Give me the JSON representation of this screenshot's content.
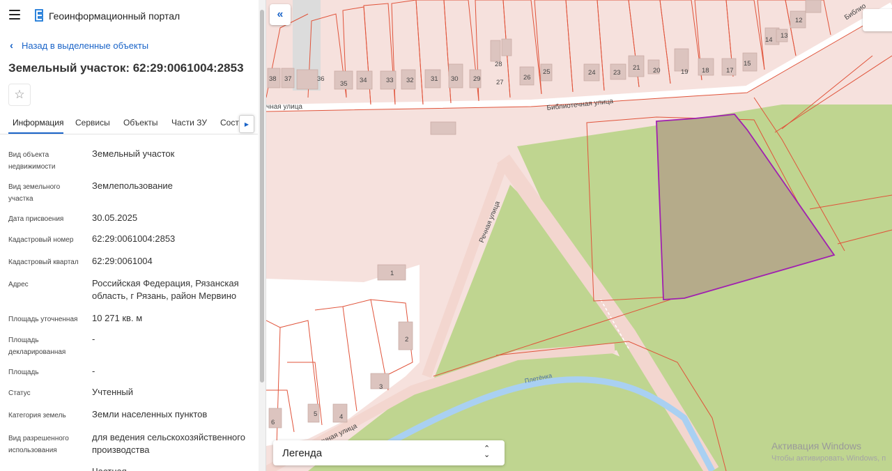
{
  "header": {
    "portal_title": "Геоинформационный портал",
    "menu_icon": "menu-icon",
    "logo_icon": "portal-logo-icon"
  },
  "back_link": "Назад в выделенные объекты",
  "object_title": "Земельный участок: 62:29:0061004:2853",
  "tabs": [
    {
      "label": "Информация"
    },
    {
      "label": "Сервисы"
    },
    {
      "label": "Объекты"
    },
    {
      "label": "Части ЗУ"
    },
    {
      "label": "Соста"
    }
  ],
  "info": [
    {
      "label": "Вид объекта недвижимости",
      "value": "Земельный участок"
    },
    {
      "label": "Вид земельного участка",
      "value": "Землепользование"
    },
    {
      "label": "Дата присвоения",
      "value": "30.05.2025"
    },
    {
      "label": "Кадастровый номер",
      "value": "62:29:0061004:2853"
    },
    {
      "label": "Кадастровый квартал",
      "value": "62:29:0061004"
    },
    {
      "label": "Адрес",
      "value": "Российская Федерация, Рязанская область, г Рязань, район Мервино"
    },
    {
      "label": "Площадь уточненная",
      "value": "10 271 кв. м"
    },
    {
      "label": "Площадь декларированная",
      "value": "-"
    },
    {
      "label": "Площадь",
      "value": "-"
    },
    {
      "label": "Статус",
      "value": "Учтенный"
    },
    {
      "label": "Категория земель",
      "value": "Земли населенных пунктов"
    },
    {
      "label": "Вид разрешенного использования",
      "value": "для ведения сельскохозяйственного производства"
    },
    {
      "label": "",
      "value": "Частная"
    }
  ],
  "map": {
    "streets": {
      "bibliotechnaya": "Библиотечная улица",
      "bibliotechnaya_left": "чная улица",
      "bibliotechnaya_top": "Библио",
      "rechnaya": "Речная улица",
      "rechnaya_bottom": "Речная улица",
      "river": "Плетёнка"
    },
    "house_numbers": [
      "38",
      "37",
      "36",
      "35",
      "34",
      "33",
      "32",
      "31",
      "30",
      "29",
      "28",
      "27",
      "26",
      "25",
      "24",
      "23",
      "21",
      "20",
      "19",
      "18",
      "17",
      "15",
      "14",
      "13",
      "12",
      "1",
      "2",
      "3",
      "4",
      "5",
      "6"
    ],
    "colors": {
      "parcel_fill": "#f6e1dd",
      "parcel_line": "#e0533a",
      "green": "#bfd590",
      "selected_fill": "#b5ab8a",
      "selected_line": "#a020b0",
      "river": "#a9d0f2",
      "road": "#f3d6cf"
    }
  },
  "legend": {
    "label": "Легенда"
  },
  "watermark": {
    "line1": "Активация Windows",
    "line2": "Чтобы активировать Windows, п"
  }
}
